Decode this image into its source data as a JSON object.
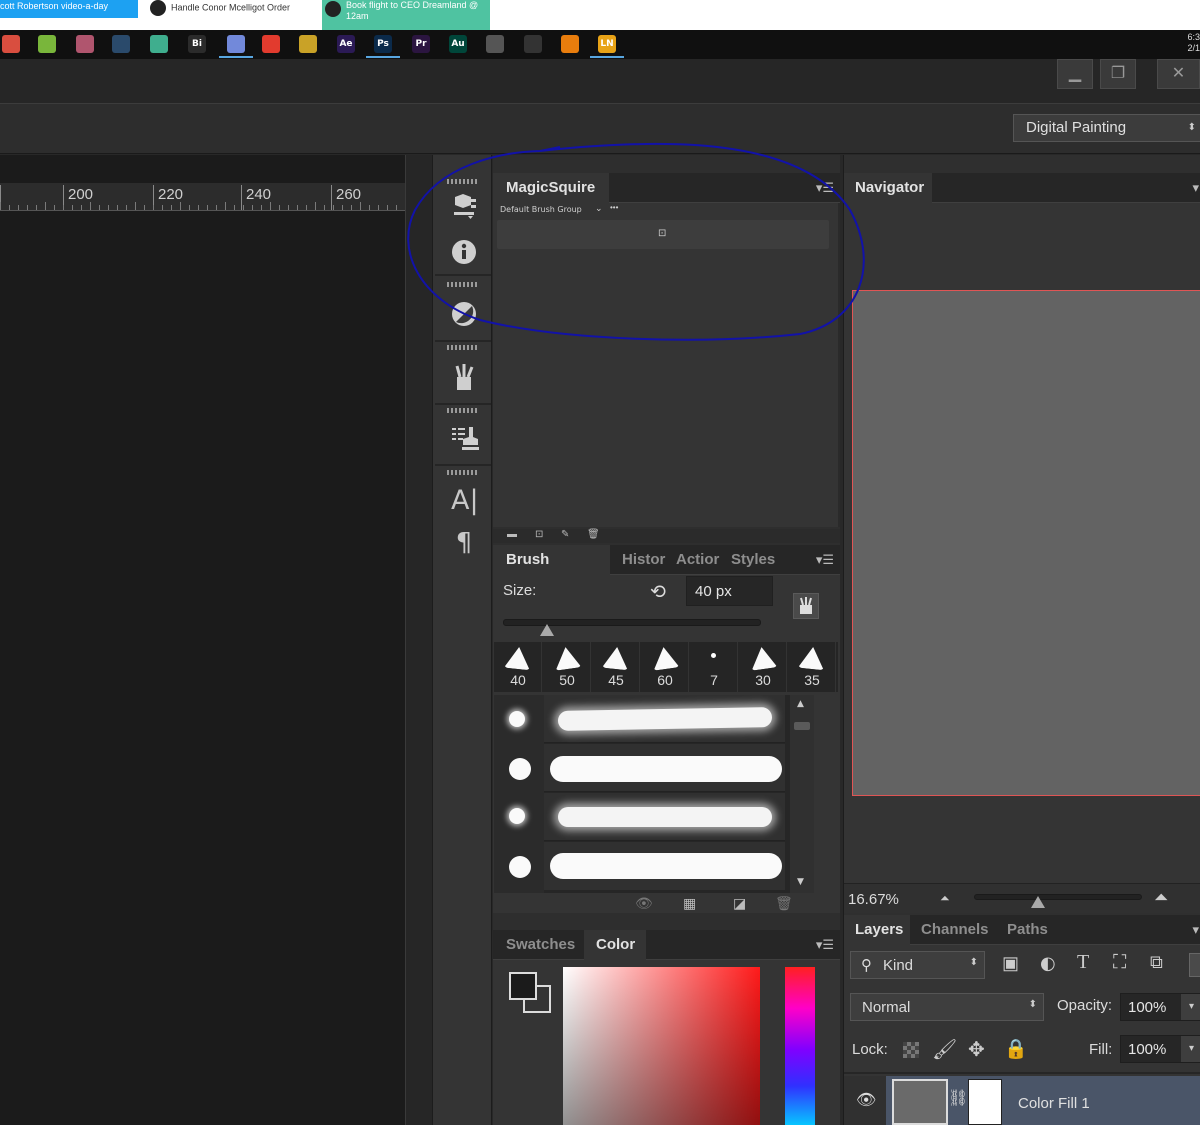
{
  "notifications": [
    {
      "text": "cott Robertson video-a-day",
      "color": "#1da1f2"
    },
    {
      "text": "Handle Conor Mcelligot Order",
      "color": "#ffffff"
    },
    {
      "text": "Book flight to CEO Dreamland @ 12am",
      "color": "#4fc3a1"
    }
  ],
  "taskbar": {
    "apps": [
      {
        "name": "chrome-icon",
        "glyph": "",
        "color": "#d94e3f"
      },
      {
        "name": "notepad-icon",
        "glyph": "",
        "color": "#79b63b"
      },
      {
        "name": "app3-icon",
        "glyph": "",
        "color": "#b0556e"
      },
      {
        "name": "steam-icon",
        "glyph": "",
        "color": "#2a4a6b"
      },
      {
        "name": "app5-icon",
        "glyph": "",
        "color": "#3fae8e"
      },
      {
        "name": "app6-icon",
        "glyph": "Bi",
        "color": "#2b2b2b"
      },
      {
        "name": "discord-icon",
        "glyph": "",
        "color": "#7289da"
      },
      {
        "name": "app8-icon",
        "glyph": "",
        "color": "#e23b2e"
      },
      {
        "name": "app9-icon",
        "glyph": "",
        "color": "#c9a227"
      },
      {
        "name": "after-effects-icon",
        "glyph": "Ae",
        "color": "#2b1a55"
      },
      {
        "name": "photoshop-icon",
        "glyph": "Ps",
        "color": "#0b2a4a"
      },
      {
        "name": "premiere-icon",
        "glyph": "Pr",
        "color": "#2b1540"
      },
      {
        "name": "audition-icon",
        "glyph": "Au",
        "color": "#00463a"
      },
      {
        "name": "app14-icon",
        "glyph": "",
        "color": "#555555"
      },
      {
        "name": "app15-icon",
        "glyph": "",
        "color": "#333333"
      },
      {
        "name": "blender-icon",
        "glyph": "",
        "color": "#e87d0d"
      },
      {
        "name": "app17-icon",
        "glyph": "LN",
        "color": "#e8a317"
      }
    ],
    "clock_time": "6:3",
    "clock_date": "2/1"
  },
  "workspace": {
    "label": "Digital Painting"
  },
  "ruler": {
    "labels": [
      "200",
      "220",
      "240",
      "260"
    ]
  },
  "magicsquire": {
    "tab_label": "MagicSquire",
    "group_label": "Default Brush Group",
    "group_more": "•••"
  },
  "brush_panel": {
    "tabs": [
      "Brush Presets",
      "Histor",
      "Actior",
      "Styles"
    ],
    "size_label": "Size:",
    "size_value": "40 px",
    "size_fraction": 0.17,
    "presets": [
      "40",
      "50",
      "45",
      "60",
      "7",
      "30",
      "35"
    ]
  },
  "color_panel": {
    "tabs": [
      "Swatches",
      "Color"
    ]
  },
  "navigator": {
    "tab_label": "Navigator",
    "zoom": "16.67%",
    "zoom_fraction": 0.38
  },
  "layers": {
    "tabs": [
      "Layers",
      "Channels",
      "Paths"
    ],
    "filter_label": "Kind",
    "blend_mode": "Normal",
    "opacity_label": "Opacity:",
    "opacity_value": "100%",
    "lock_label": "Lock:",
    "fill_label": "Fill:",
    "fill_value": "100%",
    "layer_name": "Color Fill 1"
  },
  "colors": {
    "annotation": "#1212a8",
    "nav_frame": "#e05555"
  }
}
